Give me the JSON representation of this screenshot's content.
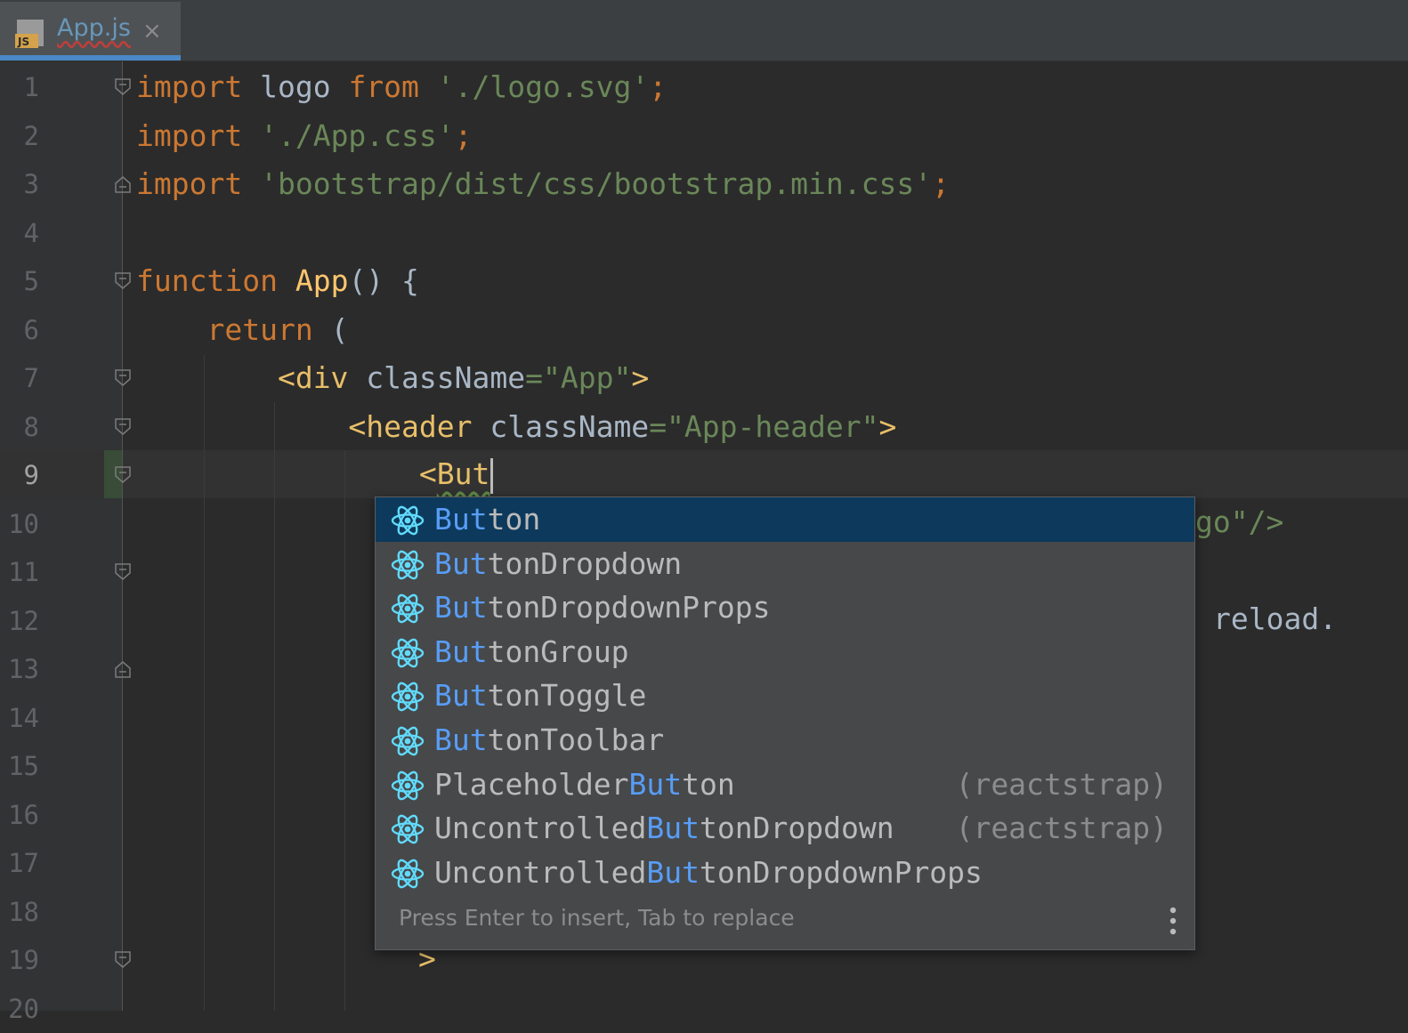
{
  "tab": {
    "title": "App.js",
    "icon": "js-file-icon",
    "close_glyph": "×"
  },
  "code_lines": [
    {
      "number": "1",
      "tokens": [
        [
          "kw",
          "import"
        ],
        [
          "plain",
          " logo "
        ],
        [
          "kw",
          "from"
        ],
        [
          "plain",
          " "
        ],
        [
          "str",
          "'./logo.svg'"
        ],
        [
          "kw",
          ";"
        ]
      ]
    },
    {
      "number": "2",
      "tokens": [
        [
          "kw",
          "import"
        ],
        [
          "plain",
          " "
        ],
        [
          "str",
          "'./App.css'"
        ],
        [
          "kw",
          ";"
        ]
      ]
    },
    {
      "number": "3",
      "tokens": [
        [
          "kw",
          "import"
        ],
        [
          "plain",
          " "
        ],
        [
          "str",
          "'bootstrap/dist/css/bootstrap.min.css'"
        ],
        [
          "kw",
          ";"
        ]
      ]
    },
    {
      "number": "4",
      "tokens": []
    },
    {
      "number": "5",
      "tokens": [
        [
          "kw",
          "function"
        ],
        [
          "plain",
          " "
        ],
        [
          "fn",
          "App"
        ],
        [
          "plain",
          "() {"
        ]
      ]
    },
    {
      "number": "6",
      "tokens": [
        [
          "plain",
          "    "
        ],
        [
          "kw",
          "return"
        ],
        [
          "plain",
          " ("
        ]
      ]
    },
    {
      "number": "7",
      "tokens": [
        [
          "plain",
          "        "
        ],
        [
          "tag",
          "<div"
        ],
        [
          "plain",
          " className"
        ],
        [
          "str",
          "=\"App\""
        ],
        [
          "tag",
          ">"
        ]
      ]
    },
    {
      "number": "8",
      "tokens": [
        [
          "plain",
          "            "
        ],
        [
          "tag",
          "<header"
        ],
        [
          "plain",
          " className"
        ],
        [
          "str",
          "=\"App-header\""
        ],
        [
          "tag",
          ">"
        ]
      ]
    },
    {
      "number": "9",
      "tokens": []
    },
    {
      "number": "10",
      "tokens": []
    },
    {
      "number": "11",
      "tokens": []
    },
    {
      "number": "12",
      "tokens": []
    },
    {
      "number": "13",
      "tokens": []
    },
    {
      "number": "14",
      "tokens": []
    },
    {
      "number": "15",
      "tokens": []
    },
    {
      "number": "16",
      "tokens": []
    },
    {
      "number": "17",
      "tokens": []
    },
    {
      "number": "18",
      "tokens": []
    },
    {
      "number": "19",
      "tokens": []
    },
    {
      "number": "20",
      "tokens": []
    }
  ],
  "current_line": {
    "indent": "                ",
    "open_bracket": "<",
    "typed": "But"
  },
  "partial_text": {
    "line10_tail": "go\"/>",
    "line12_tail": "reload.",
    "line19_tail": ">"
  },
  "completion": {
    "items": [
      {
        "prefix": "",
        "match": "But",
        "suffix": "ton",
        "source": "",
        "icon": "react-component-icon",
        "selected": true
      },
      {
        "prefix": "",
        "match": "But",
        "suffix": "tonDropdown",
        "source": "",
        "icon": "react-component-icon",
        "selected": false
      },
      {
        "prefix": "",
        "match": "But",
        "suffix": "tonDropdownProps",
        "source": "",
        "icon": "react-component-icon",
        "selected": false
      },
      {
        "prefix": "",
        "match": "But",
        "suffix": "tonGroup",
        "source": "",
        "icon": "react-component-icon",
        "selected": false
      },
      {
        "prefix": "",
        "match": "But",
        "suffix": "tonToggle",
        "source": "",
        "icon": "react-component-icon",
        "selected": false
      },
      {
        "prefix": "",
        "match": "But",
        "suffix": "tonToolbar",
        "source": "",
        "icon": "react-component-icon",
        "selected": false
      },
      {
        "prefix": "Placeholder",
        "match": "But",
        "suffix": "ton",
        "source": "(reactstrap)",
        "icon": "react-component-icon",
        "selected": false
      },
      {
        "prefix": "Uncontrolled",
        "match": "But",
        "suffix": "tonDropdown",
        "source": "(reactstrap)",
        "icon": "react-component-icon",
        "selected": false
      },
      {
        "prefix": "Uncontrolled",
        "match": "But",
        "suffix": "tonDropdownProps",
        "source": "",
        "icon": "react-component-icon",
        "selected": false
      }
    ],
    "footer_hint": "Press Enter to insert, Tab to replace",
    "menu_icon": "more-vertical-icon"
  },
  "colors": {
    "background": "#2b2b2b",
    "keyword": "#cc7832",
    "string": "#6a8759",
    "tag": "#e8bf6a",
    "match_highlight": "#589df6",
    "selection": "#0d3a5c",
    "react_icon": "#61dafb"
  }
}
